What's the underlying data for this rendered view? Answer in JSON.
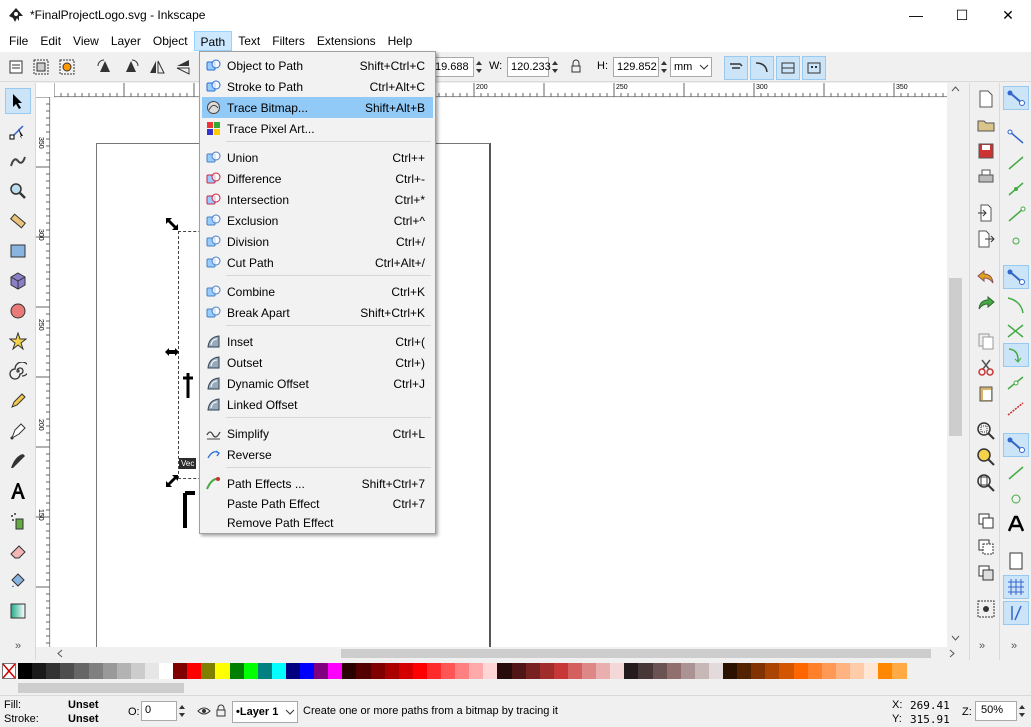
{
  "window": {
    "title": "*FinalProjectLogo.svg - Inkscape",
    "minimize": "—",
    "maximize": "☐",
    "close": "✕"
  },
  "menubar": {
    "items": [
      "File",
      "Edit",
      "View",
      "Layer",
      "Object",
      "Path",
      "Text",
      "Filters",
      "Extensions",
      "Help"
    ],
    "active": "Path"
  },
  "controls": {
    "x_value": "19.688",
    "w_label": "W:",
    "w_value": "120.233",
    "h_label": "H:",
    "h_value": "129.852",
    "unit": "mm"
  },
  "ruler": {
    "h_labels": [
      "200",
      "250",
      "300",
      "350"
    ],
    "v_labels": [
      "350",
      "300",
      "250",
      "200",
      "150"
    ]
  },
  "path_menu": [
    {
      "label": "Object to Path",
      "accel": "Shift+Ctrl+C",
      "icon": "object-to-path-icon"
    },
    {
      "label": "Stroke to Path",
      "accel": "Ctrl+Alt+C",
      "icon": "stroke-to-path-icon"
    },
    {
      "label": "Trace Bitmap...",
      "accel": "Shift+Alt+B",
      "icon": "trace-bitmap-icon",
      "hover": true
    },
    {
      "label": "Trace Pixel Art...",
      "accel": "",
      "icon": "trace-pixel-art-icon"
    },
    {
      "label": "Union",
      "accel": "Ctrl++",
      "icon": "union-icon"
    },
    {
      "label": "Difference",
      "accel": "Ctrl+-",
      "icon": "difference-icon"
    },
    {
      "label": "Intersection",
      "accel": "Ctrl+*",
      "icon": "intersection-icon"
    },
    {
      "label": "Exclusion",
      "accel": "Ctrl+^",
      "icon": "exclusion-icon"
    },
    {
      "label": "Division",
      "accel": "Ctrl+/",
      "icon": "division-icon"
    },
    {
      "label": "Cut Path",
      "accel": "Ctrl+Alt+/",
      "icon": "cut-path-icon"
    },
    {
      "label": "Combine",
      "accel": "Ctrl+K",
      "icon": "combine-icon"
    },
    {
      "label": "Break Apart",
      "accel": "Shift+Ctrl+K",
      "icon": "break-apart-icon"
    },
    {
      "label": "Inset",
      "accel": "Ctrl+(",
      "icon": "inset-icon"
    },
    {
      "label": "Outset",
      "accel": "Ctrl+)",
      "icon": "outset-icon"
    },
    {
      "label": "Dynamic Offset",
      "accel": "Ctrl+J",
      "icon": "dynamic-offset-icon"
    },
    {
      "label": "Linked Offset",
      "accel": "",
      "icon": "linked-offset-icon"
    },
    {
      "label": "Simplify",
      "accel": "Ctrl+L",
      "icon": "simplify-icon"
    },
    {
      "label": "Reverse",
      "accel": "",
      "icon": "reverse-icon"
    },
    {
      "label": "Path Effects ...",
      "accel": "Shift+Ctrl+7",
      "icon": "path-effects-icon"
    },
    {
      "label": "Paste Path Effect",
      "accel": "Ctrl+7",
      "icon": ""
    },
    {
      "label": "Remove Path Effect",
      "accel": "",
      "icon": ""
    }
  ],
  "canvas": {
    "tooltip": "Vec"
  },
  "status": {
    "fill_label": "Fill:",
    "fill_value": "Unset",
    "stroke_label": "Stroke:",
    "stroke_value": "Unset",
    "opacity_label": "O:",
    "opacity_value": "0",
    "layer": "•Layer 1",
    "message": "Create one or more paths from a bitmap by tracing it",
    "x_label": "X:",
    "x_value": "269.41",
    "y_label": "Y:",
    "y_value": "315.91",
    "zoom_label": "Z:",
    "zoom_value": "50%"
  },
  "palette_colors": [
    "#000000",
    "#1a1a1a",
    "#333333",
    "#4d4d4d",
    "#666666",
    "#808080",
    "#999999",
    "#b3b3b3",
    "#cccccc",
    "#e6e6e6",
    "#ffffff",
    "#800000",
    "#ff0000",
    "#808000",
    "#ffff00",
    "#008000",
    "#00ff00",
    "#008080",
    "#00ffff",
    "#000080",
    "#0000ff",
    "#800080",
    "#ff00ff",
    "#2b0000",
    "#550000",
    "#800000",
    "#aa0000",
    "#d40000",
    "#ff0000",
    "#ff2a2a",
    "#ff5555",
    "#ff8080",
    "#ffaaaa",
    "#ffd5d5",
    "#280b0b",
    "#501616",
    "#782121",
    "#a02c2c",
    "#c83737",
    "#d35f5f",
    "#de8787",
    "#e9afaf",
    "#f4d7d7",
    "#241c1c",
    "#483737",
    "#6c5353",
    "#916f6f",
    "#ac9393",
    "#c8b7b7",
    "#e3dbdb",
    "#2b1100",
    "#552200",
    "#803300",
    "#aa4400",
    "#d45500",
    "#ff6600",
    "#ff7f2a",
    "#ff9955",
    "#ffb380",
    "#ffccaa",
    "#ffe6d5",
    "#ff8800",
    "#ffaa44"
  ]
}
